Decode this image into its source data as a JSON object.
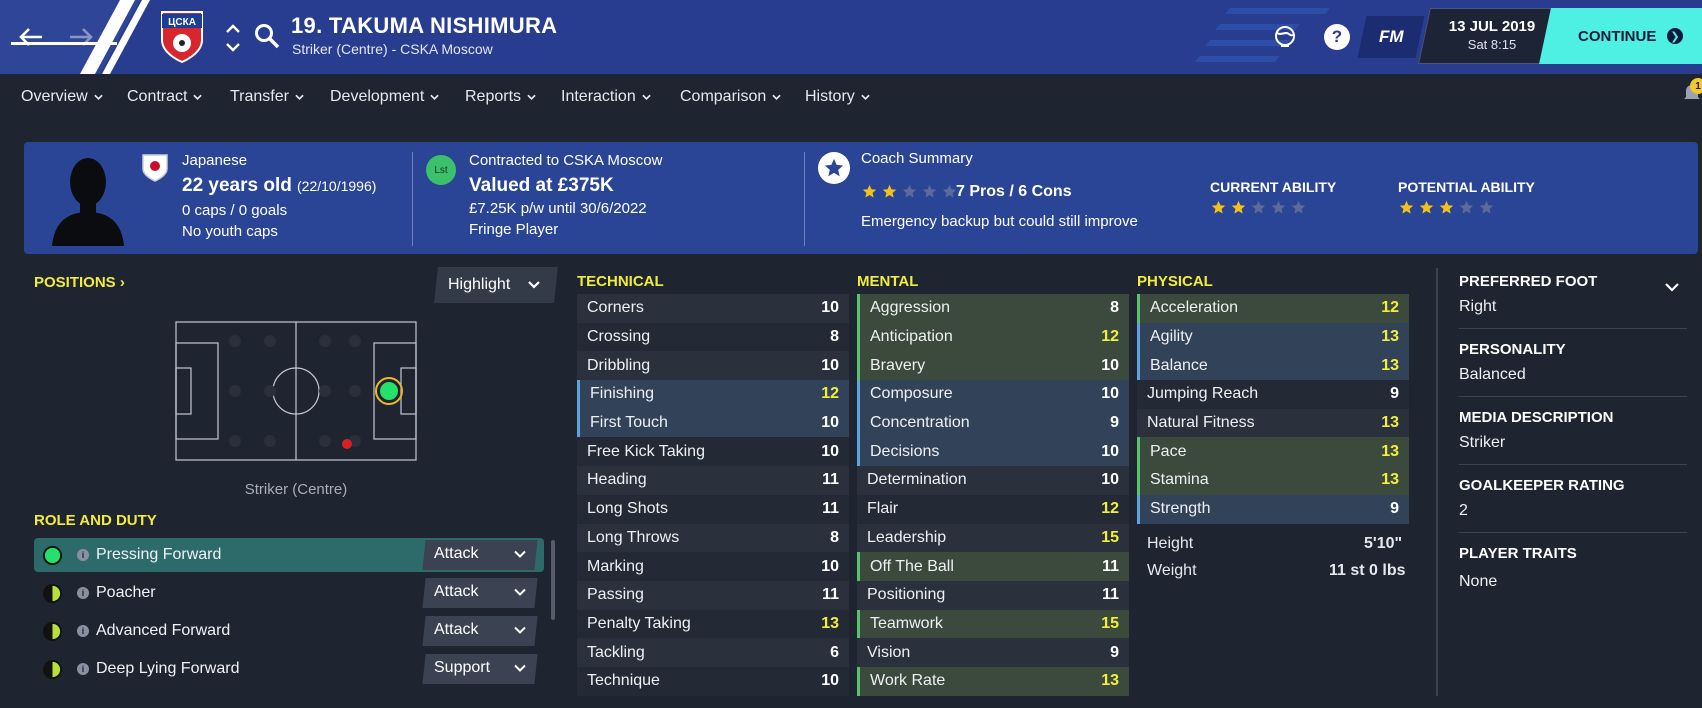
{
  "header": {
    "player_title": "19. TAKUMA NISHIMURA",
    "player_subtitle": "Striker (Centre) - CSKA Moscow",
    "club_badge_text": "ЦСКА",
    "fm_label": "FM",
    "date": "13 JUL 2019",
    "time": "Sat 8:15",
    "continue_label": "CONTINUE",
    "notification_count": "1"
  },
  "tabs": [
    {
      "label": "Overview"
    },
    {
      "label": "Contract"
    },
    {
      "label": "Transfer"
    },
    {
      "label": "Development"
    },
    {
      "label": "Reports"
    },
    {
      "label": "Interaction"
    },
    {
      "label": "Comparison"
    },
    {
      "label": "History"
    }
  ],
  "info": {
    "nationality": "Japanese",
    "age": "22 years old",
    "dob": "(22/10/1996)",
    "caps": "0 caps / 0 goals",
    "youth_caps": "No youth caps",
    "contract_badge": "Lst",
    "contracted_to": "Contracted to CSKA Moscow",
    "value": "Valued at £375K",
    "wage": "£7.25K p/w until 30/6/2022",
    "squad_status": "Fringe Player",
    "coach_summary_label": "Coach Summary",
    "pros_cons": "7 Pros / 6 Cons",
    "summary_stars": 2,
    "summary_text": "Emergency backup but could still improve",
    "current_ability_label": "CURRENT ABILITY",
    "current_ability_stars": 2,
    "potential_ability_label": "POTENTIAL ABILITY",
    "potential_ability_stars": 3
  },
  "positions": {
    "heading": "POSITIONS",
    "highlight_label": "Highlight",
    "caption": "Striker (Centre)"
  },
  "roles": {
    "heading": "ROLE AND DUTY",
    "items": [
      {
        "name": "Pressing Forward",
        "duty": "Attack"
      },
      {
        "name": "Poacher",
        "duty": "Attack"
      },
      {
        "name": "Advanced Forward",
        "duty": "Attack"
      },
      {
        "name": "Deep Lying Forward",
        "duty": "Support"
      }
    ]
  },
  "technical": {
    "heading": "TECHNICAL",
    "rows": [
      {
        "name": "Corners",
        "value": "10"
      },
      {
        "name": "Crossing",
        "value": "8"
      },
      {
        "name": "Dribbling",
        "value": "10"
      },
      {
        "name": "Finishing",
        "value": "12"
      },
      {
        "name": "First Touch",
        "value": "10"
      },
      {
        "name": "Free Kick Taking",
        "value": "10"
      },
      {
        "name": "Heading",
        "value": "11"
      },
      {
        "name": "Long Shots",
        "value": "11"
      },
      {
        "name": "Long Throws",
        "value": "8"
      },
      {
        "name": "Marking",
        "value": "10"
      },
      {
        "name": "Passing",
        "value": "11"
      },
      {
        "name": "Penalty Taking",
        "value": "13"
      },
      {
        "name": "Tackling",
        "value": "6"
      },
      {
        "name": "Technique",
        "value": "10"
      }
    ]
  },
  "mental": {
    "heading": "MENTAL",
    "rows": [
      {
        "name": "Aggression",
        "value": "8"
      },
      {
        "name": "Anticipation",
        "value": "12"
      },
      {
        "name": "Bravery",
        "value": "10"
      },
      {
        "name": "Composure",
        "value": "10"
      },
      {
        "name": "Concentration",
        "value": "9"
      },
      {
        "name": "Decisions",
        "value": "10"
      },
      {
        "name": "Determination",
        "value": "10"
      },
      {
        "name": "Flair",
        "value": "12"
      },
      {
        "name": "Leadership",
        "value": "15"
      },
      {
        "name": "Off The Ball",
        "value": "11"
      },
      {
        "name": "Positioning",
        "value": "11"
      },
      {
        "name": "Teamwork",
        "value": "15"
      },
      {
        "name": "Vision",
        "value": "9"
      },
      {
        "name": "Work Rate",
        "value": "13"
      }
    ]
  },
  "physical": {
    "heading": "PHYSICAL",
    "rows": [
      {
        "name": "Acceleration",
        "value": "12"
      },
      {
        "name": "Agility",
        "value": "13"
      },
      {
        "name": "Balance",
        "value": "13"
      },
      {
        "name": "Jumping Reach",
        "value": "9"
      },
      {
        "name": "Natural Fitness",
        "value": "13"
      },
      {
        "name": "Pace",
        "value": "13"
      },
      {
        "name": "Stamina",
        "value": "13"
      },
      {
        "name": "Strength",
        "value": "9"
      }
    ],
    "height_label": "Height",
    "height_value": "5'10\"",
    "weight_label": "Weight",
    "weight_value": "11 st 0 lbs"
  },
  "details": {
    "preferred_foot_label": "PREFERRED FOOT",
    "preferred_foot": "Right",
    "personality_label": "PERSONALITY",
    "personality": "Balanced",
    "media_label": "MEDIA DESCRIPTION",
    "media": "Striker",
    "gk_rating_label": "GOALKEEPER RATING",
    "gk_rating": "2",
    "traits_label": "PLAYER TRAITS",
    "traits": "None"
  },
  "colors": {
    "topbar": "#283d8f",
    "info_panel": "#2b4596",
    "accent_yellow": "#f2ec3d",
    "continue": "#4ef0e3",
    "star_gold": "#f2c21b"
  }
}
